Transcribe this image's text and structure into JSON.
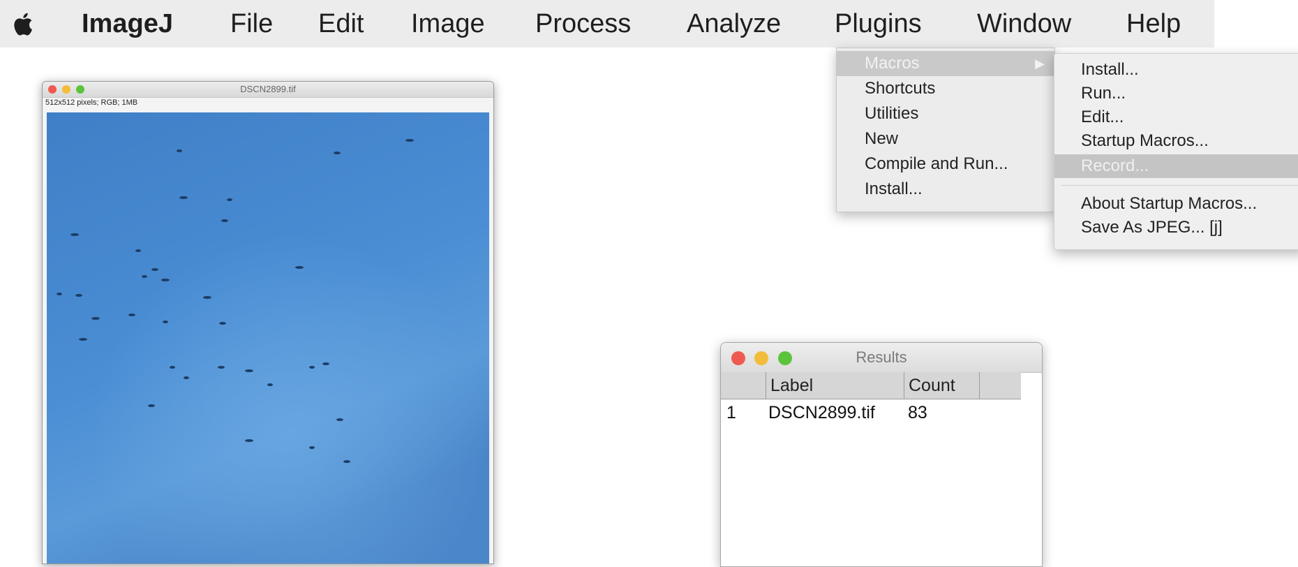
{
  "menubar": {
    "apple_icon": "apple-icon",
    "items": [
      "ImageJ",
      "File",
      "Edit",
      "Image",
      "Process",
      "Analyze",
      "Plugins",
      "Window",
      "Help"
    ]
  },
  "image_window": {
    "title": "DSCN2899.tif",
    "info": "512x512 pixels; RGB; 1MB",
    "sky_color": "#4a88cc"
  },
  "plugins_menu": {
    "items": [
      {
        "label": "Macros",
        "highlighted": true,
        "has_submenu": true
      },
      {
        "label": "Shortcuts"
      },
      {
        "label": "Utilities"
      },
      {
        "label": "New"
      },
      {
        "label": "Compile and Run..."
      },
      {
        "label": "Install..."
      }
    ],
    "submenu_arrow": "▶"
  },
  "macros_submenu": {
    "items": [
      "Install...",
      "Run...",
      "Edit...",
      "Startup Macros...",
      "Record...",
      "About Startup Macros...",
      "Save As JPEG... [j]"
    ],
    "highlighted_index": 4
  },
  "results_window": {
    "title": "Results",
    "columns": [
      "Label",
      "Count"
    ],
    "rows": [
      {
        "index": "1",
        "label": "DSCN2899.tif",
        "count": "83"
      }
    ]
  },
  "colors": {
    "menubar_bg": "#ececec",
    "highlight": "#c6c6c6",
    "close": "#ee5a52",
    "minimize": "#f3bd3b",
    "zoom": "#5bc43c"
  }
}
